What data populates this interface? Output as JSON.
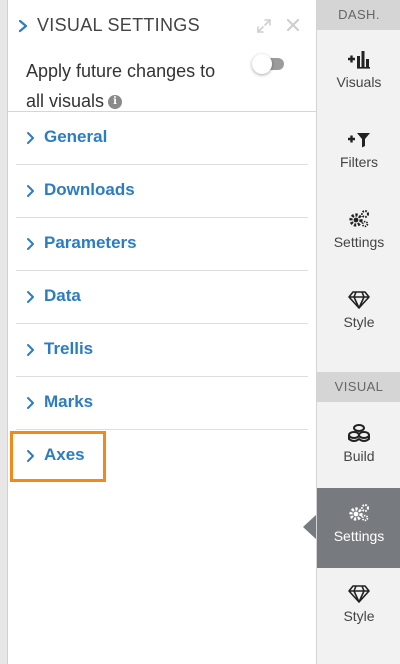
{
  "panel": {
    "title": "VISUAL SETTINGS",
    "apply_line1": "Apply future changes to",
    "apply_line2": "all visuals",
    "apply_toggle_on": false,
    "info_glyph": "i"
  },
  "sections": [
    {
      "label": "General"
    },
    {
      "label": "Downloads"
    },
    {
      "label": "Parameters"
    },
    {
      "label": "Data"
    },
    {
      "label": "Trellis"
    },
    {
      "label": "Marks"
    },
    {
      "label": "Axes",
      "highlighted": true
    }
  ],
  "rail": {
    "dash_header": "DASH.",
    "visual_header": "VISUAL",
    "dash_items": [
      {
        "label": "Visuals",
        "icon": "add-chart-icon"
      },
      {
        "label": "Filters",
        "icon": "add-filter-icon"
      },
      {
        "label": "Settings",
        "icon": "gears-icon"
      },
      {
        "label": "Style",
        "icon": "diamond-icon"
      }
    ],
    "visual_items": [
      {
        "label": "Build",
        "icon": "build-blocks-icon"
      },
      {
        "label": "Settings",
        "icon": "gears-icon",
        "active": true
      },
      {
        "label": "Style",
        "icon": "diamond-icon"
      }
    ]
  },
  "colors": {
    "accent": "#2b7dc1",
    "highlight": "#f28a1b",
    "rail_active": "#777b80"
  }
}
